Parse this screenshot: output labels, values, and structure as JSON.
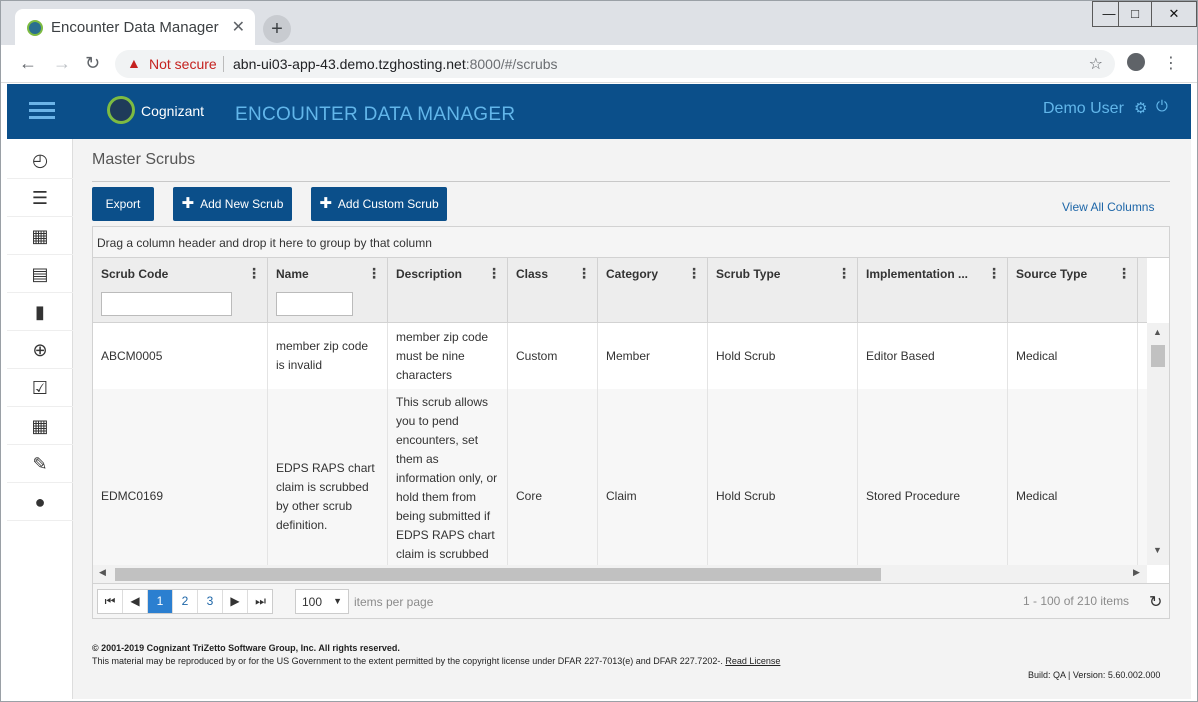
{
  "browser": {
    "tab_title": "Encounter Data Manager",
    "tab_close": "✕",
    "new_tab": "+",
    "not_secure": "Not secure",
    "url_host": "abn-ui03-app-43.demo.tzghosting.net",
    "url_rest": ":8000/#/scrubs",
    "win_min": "—",
    "win_max": "□",
    "win_close": "✕"
  },
  "header": {
    "logo_text": "Cognizant",
    "app_title": "ENCOUNTER DATA MANAGER",
    "user_name": "Demo User"
  },
  "sidebar": {
    "items": [
      {
        "icon": "dashboard-icon",
        "glyph": "◴"
      },
      {
        "icon": "server-icon",
        "glyph": "☰"
      },
      {
        "icon": "calendar-icon",
        "glyph": "▦"
      },
      {
        "icon": "list-icon",
        "glyph": "▤"
      },
      {
        "icon": "file-icon",
        "glyph": "▮"
      },
      {
        "icon": "upload-icon",
        "glyph": "⊕"
      },
      {
        "icon": "checkbox-icon",
        "glyph": "☑"
      },
      {
        "icon": "grid-icon",
        "glyph": "▦"
      },
      {
        "icon": "wrench-icon",
        "glyph": "✎"
      },
      {
        "icon": "user-icon",
        "glyph": "●"
      }
    ]
  },
  "page": {
    "title": "Master Scrubs",
    "export_label": "Export",
    "add_new_label": "Add New Scrub",
    "add_custom_label": "Add Custom Scrub",
    "view_all_label": "View All Columns",
    "group_hint": "Drag a column header and drop it here to group by that column"
  },
  "grid": {
    "columns": [
      {
        "label": "Scrub Code"
      },
      {
        "label": "Name"
      },
      {
        "label": "Description"
      },
      {
        "label": "Class"
      },
      {
        "label": "Category"
      },
      {
        "label": "Scrub Type"
      },
      {
        "label": "Implementation ..."
      },
      {
        "label": "Source Type"
      }
    ],
    "rows": [
      {
        "scrub_code": "ABCM0005",
        "name": "member zip code is invalid",
        "description": "member zip code must be nine characters",
        "class": "Custom",
        "category": "Member",
        "scrub_type": "Hold Scrub",
        "implementation": "Editor Based",
        "source_type": "Medical"
      },
      {
        "scrub_code": "EDMC0169",
        "name": "EDPS RAPS chart claim is scrubbed by other scrub definition.",
        "description": "This scrub allows you to pend encounters, set them as information only, or hold them from being submitted if EDPS RAPS chart claim is scrubbed",
        "class": "Core",
        "category": "Claim",
        "scrub_type": "Hold Scrub",
        "implementation": "Stored Procedure",
        "source_type": "Medical"
      }
    ]
  },
  "pager": {
    "first": "⏮",
    "prev": "◀",
    "pages": [
      "1",
      "2",
      "3"
    ],
    "next": "▶",
    "last": "⏭",
    "page_size": "100",
    "items_per_page": "items per page",
    "range": "1 - 100 of 210 items"
  },
  "footer": {
    "copyright": "© 2001-2019 Cognizant TriZetto Software Group, Inc. All rights reserved.",
    "legal": "This material may be reproduced by or for the US Government to the extent permitted by the copyright license under DFAR 227-7013(e) and DFAR 227.7202-.",
    "read_license": "Read License",
    "build": "Build: QA | Version: 5.60.002.000"
  }
}
